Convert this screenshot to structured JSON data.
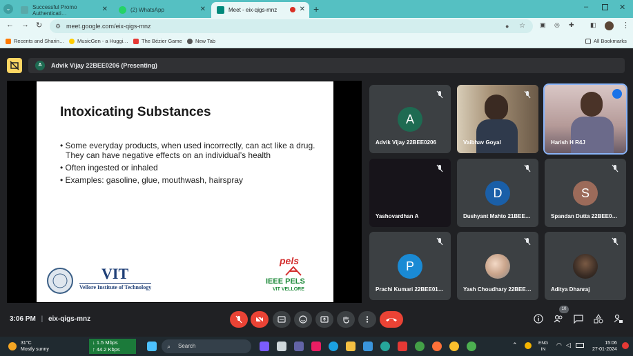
{
  "browser": {
    "tabs": [
      {
        "title": "Successful Promo Authenticati…",
        "active": false
      },
      {
        "title": "(2) WhatsApp",
        "active": false
      },
      {
        "title": "Meet - eix-qigs-mnz",
        "active": true
      }
    ],
    "url": "meet.google.com/eix-qigs-mnz",
    "bookmarks": [
      "Recents and Sharin…",
      "MusicGen - a Huggi…",
      "The Bézier Game",
      "New Tab"
    ],
    "all_bookmarks": "All Bookmarks"
  },
  "meet": {
    "presenter_initial": "A",
    "presenter_banner": "Advik Vijay 22BEE0206 (Presenting)",
    "slide": {
      "title": "Intoxicating Substances",
      "bullets": [
        "• Some everyday products, when used incorrectly, can act like a drug.  They can have negative effects on an individual’s health",
        "• Often ingested or inhaled",
        "• Examples:  gasoline, glue, mouthwash, hairspray"
      ],
      "logo_left_text": "VIT",
      "logo_left_sub": "Vellore Institute of Technology",
      "logo_right_top": "pels",
      "logo_right_main": "IEEE PELS",
      "logo_right_sub": "VIT VELLORE"
    },
    "participants": [
      {
        "name": "Advik Vijay 22BEE0206",
        "initial": "A",
        "color": "#1e6b52",
        "type": "avatar"
      },
      {
        "name": "Vaibhav Goyal",
        "initial": "",
        "color": "",
        "type": "video"
      },
      {
        "name": "Harish H R4J",
        "initial": "",
        "color": "",
        "type": "video"
      },
      {
        "name": "Yashovardhan A",
        "initial": "",
        "color": "",
        "type": "dark"
      },
      {
        "name": "Dushyant Mahto 21BEE…",
        "initial": "D",
        "color": "#1a5fa8",
        "type": "avatar"
      },
      {
        "name": "Spandan Dutta 22BEE0…",
        "initial": "S",
        "color": "#9c6b5a",
        "type": "avatar"
      },
      {
        "name": "Prachi Kumari 22BEE01…",
        "initial": "P",
        "color": "#1a8ad4",
        "type": "avatar"
      },
      {
        "name": "Yash Choudhary 22BEE…",
        "initial": "",
        "color": "",
        "type": "photo"
      },
      {
        "name": "Aditya Dhanraj",
        "initial": "",
        "color": "",
        "type": "photo"
      }
    ],
    "time": "3:06 PM",
    "separator": "|",
    "meeting_code": "eix-qigs-mnz",
    "people_count": "10"
  },
  "taskbar": {
    "temp": "31°C",
    "weather": "Mostly sunny",
    "down": "↓ 1.5 Mbps",
    "up": "↑ 44.2 Kbps",
    "search": "Search",
    "lang1": "ENG",
    "lang2": "IN",
    "time": "15:06",
    "date": "27-01-2024"
  }
}
